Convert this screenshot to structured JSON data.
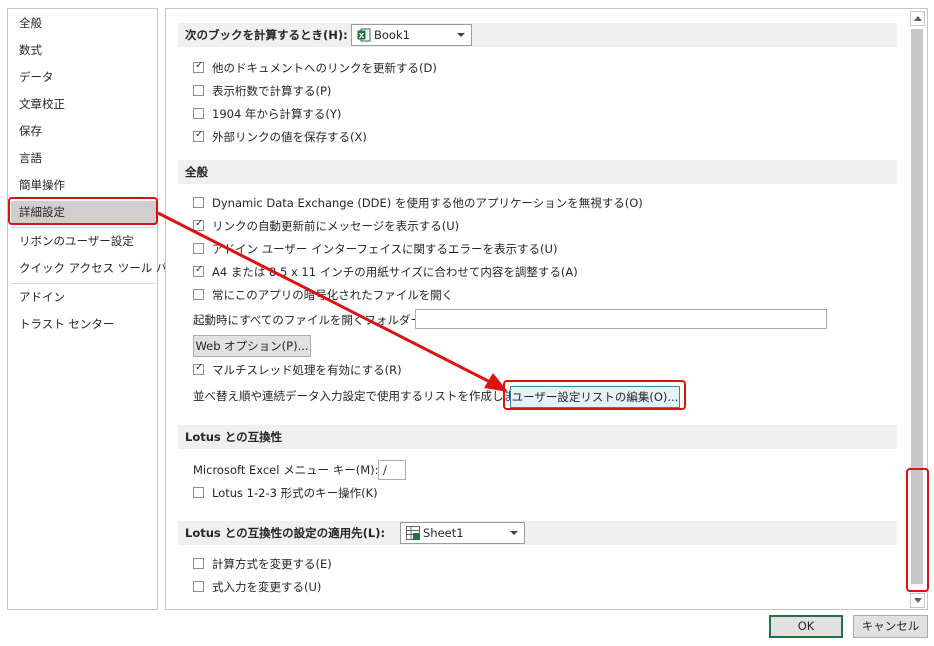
{
  "sidebar": {
    "items": [
      {
        "label": "全般"
      },
      {
        "label": "数式"
      },
      {
        "label": "データ"
      },
      {
        "label": "文章校正"
      },
      {
        "label": "保存"
      },
      {
        "label": "言語"
      },
      {
        "label": "簡単操作"
      },
      {
        "label": "詳細設定",
        "selected": true
      },
      {
        "label": "リボンのユーザー設定"
      },
      {
        "label": "クイック アクセス ツール バー"
      },
      {
        "label": "アドイン"
      },
      {
        "label": "トラスト センター"
      }
    ]
  },
  "sections": {
    "calc_workbook": {
      "header": "次のブックを計算するとき(H):",
      "combo_value": "Book1",
      "combo_icon": "excel-workbook-icon",
      "options": [
        {
          "label": "他のドキュメントへのリンクを更新する(D)",
          "checked": true
        },
        {
          "label": "表示桁数で計算する(P)",
          "checked": false
        },
        {
          "label": "1904 年から計算する(Y)",
          "checked": false
        },
        {
          "label": "外部リンクの値を保存する(X)",
          "checked": true
        }
      ]
    },
    "general": {
      "header": "全般",
      "options": [
        {
          "label": "Dynamic Data Exchange (DDE) を使用する他のアプリケーションを無視する(O)",
          "checked": false
        },
        {
          "label": "リンクの自動更新前にメッセージを表示する(U)",
          "checked": true
        },
        {
          "label": "アドイン ユーザー インターフェイスに関するエラーを表示する(U)",
          "checked": false
        },
        {
          "label": "A4 または 8.5 x 11 インチの用紙サイズに合わせて内容を調整する(A)",
          "checked": true
        },
        {
          "label": "常にこのアプリの暗号化されたファイルを開く",
          "checked": false
        }
      ],
      "startup_folder_label": "起動時にすべてのファイルを開くフォルダー(L):",
      "startup_folder_value": "",
      "web_options_button": "Web オプション(P)...",
      "multithread": {
        "label": "マルチスレッド処理を有効にする(R)",
        "checked": true
      },
      "custom_list_label": "並べ替え順や連続データ入力設定で使用するリストを作成します:",
      "custom_list_button": "ユーザー設定リストの編集(O)..."
    },
    "lotus_compat": {
      "header": "Lotus との互換性",
      "menu_key_label": "Microsoft Excel メニュー キー(M):",
      "menu_key_value": "/",
      "option": {
        "label": "Lotus 1-2-3 形式のキー操作(K)",
        "checked": false
      }
    },
    "lotus_compat_settings": {
      "header": "Lotus との互換性の設定の適用先(L):",
      "combo_value": "Sheet1",
      "combo_icon": "excel-sheet-icon",
      "options": [
        {
          "label": "計算方式を変更する(E)",
          "checked": false
        },
        {
          "label": "式入力を変更する(U)",
          "checked": false
        }
      ]
    }
  },
  "footer": {
    "ok_label": "OK",
    "cancel_label": "キャンセル"
  },
  "check_mark": "✓",
  "colors": {
    "highlight": "#e01010",
    "excel_green": "#217346",
    "selected_nav": "#cfcfcf"
  }
}
